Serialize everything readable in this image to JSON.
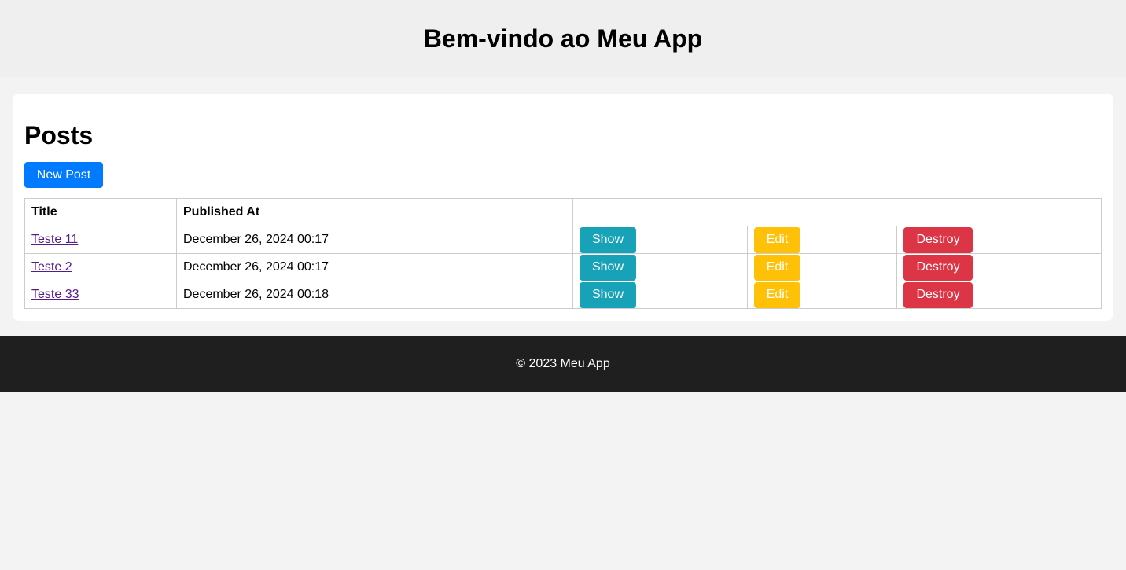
{
  "header": {
    "title": "Bem-vindo ao Meu App"
  },
  "main": {
    "title": "Posts",
    "new_post_label": "New Post"
  },
  "table": {
    "columns": [
      "Title",
      "Published At",
      ""
    ],
    "rows": [
      {
        "title": "Teste 11",
        "published_at": "December 26, 2024 00:17",
        "show": "Show",
        "edit": "Edit",
        "destroy": "Destroy"
      },
      {
        "title": "Teste 2",
        "published_at": "December 26, 2024 00:17",
        "show": "Show",
        "edit": "Edit",
        "destroy": "Destroy"
      },
      {
        "title": "Teste 33",
        "published_at": "December 26, 2024 00:18",
        "show": "Show",
        "edit": "Edit",
        "destroy": "Destroy"
      }
    ]
  },
  "footer": {
    "text": "© 2023 Meu App"
  },
  "colors": {
    "primary": "#007bff",
    "show": "#17a2b8",
    "edit": "#ffc107",
    "destroy": "#dc3545",
    "footer_bg": "#1f1f1f"
  }
}
